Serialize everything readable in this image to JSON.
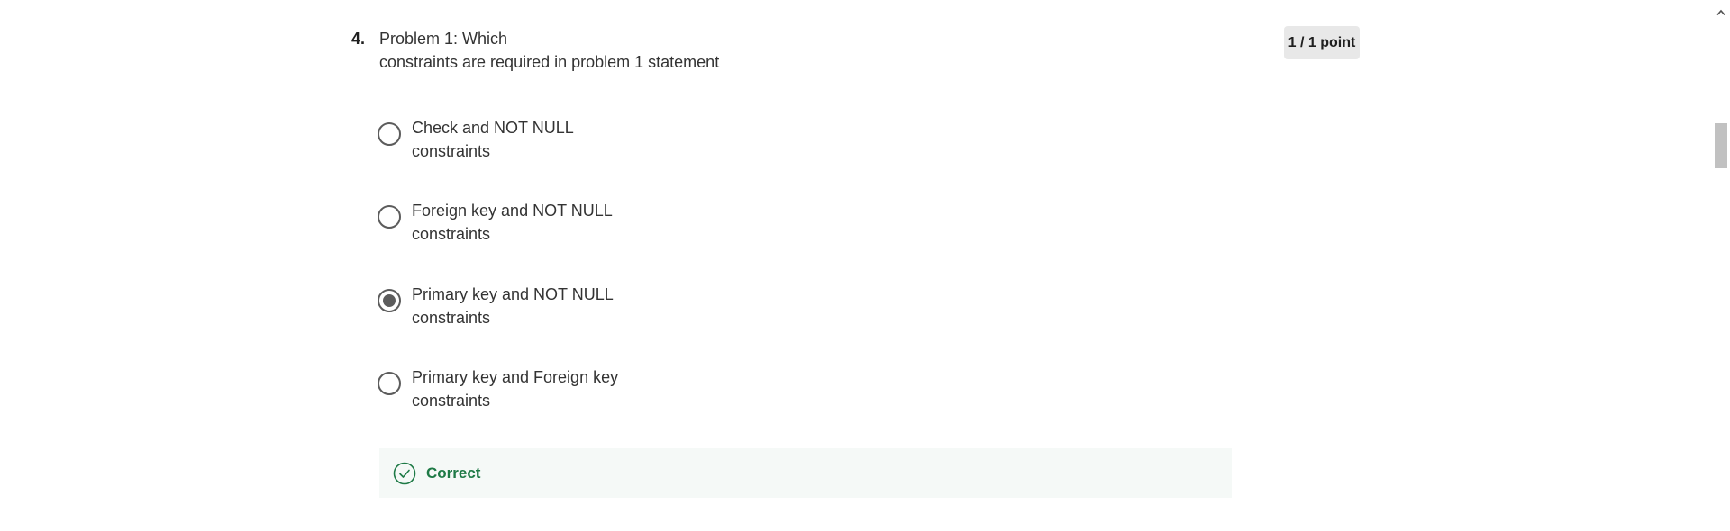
{
  "question": {
    "number": "4.",
    "text_line1": "Problem 1: Which",
    "text_line2": "constraints are required in problem 1 statement",
    "points": "1 / 1 point",
    "options": [
      {
        "line1": "Check and NOT NULL",
        "line2": "constraints",
        "selected": false
      },
      {
        "line1": "Foreign key and NOT NULL",
        "line2": "constraints",
        "selected": false
      },
      {
        "line1": "Primary key and NOT NULL",
        "line2": "constraints",
        "selected": true
      },
      {
        "line1": "Primary key and Foreign key",
        "line2": "constraints",
        "selected": false
      }
    ],
    "feedback": {
      "label": "Correct",
      "icon": "check-circle-icon",
      "color": "#1e7a46"
    }
  },
  "scrollbar": {
    "up_icon": "chevron-up-icon"
  }
}
